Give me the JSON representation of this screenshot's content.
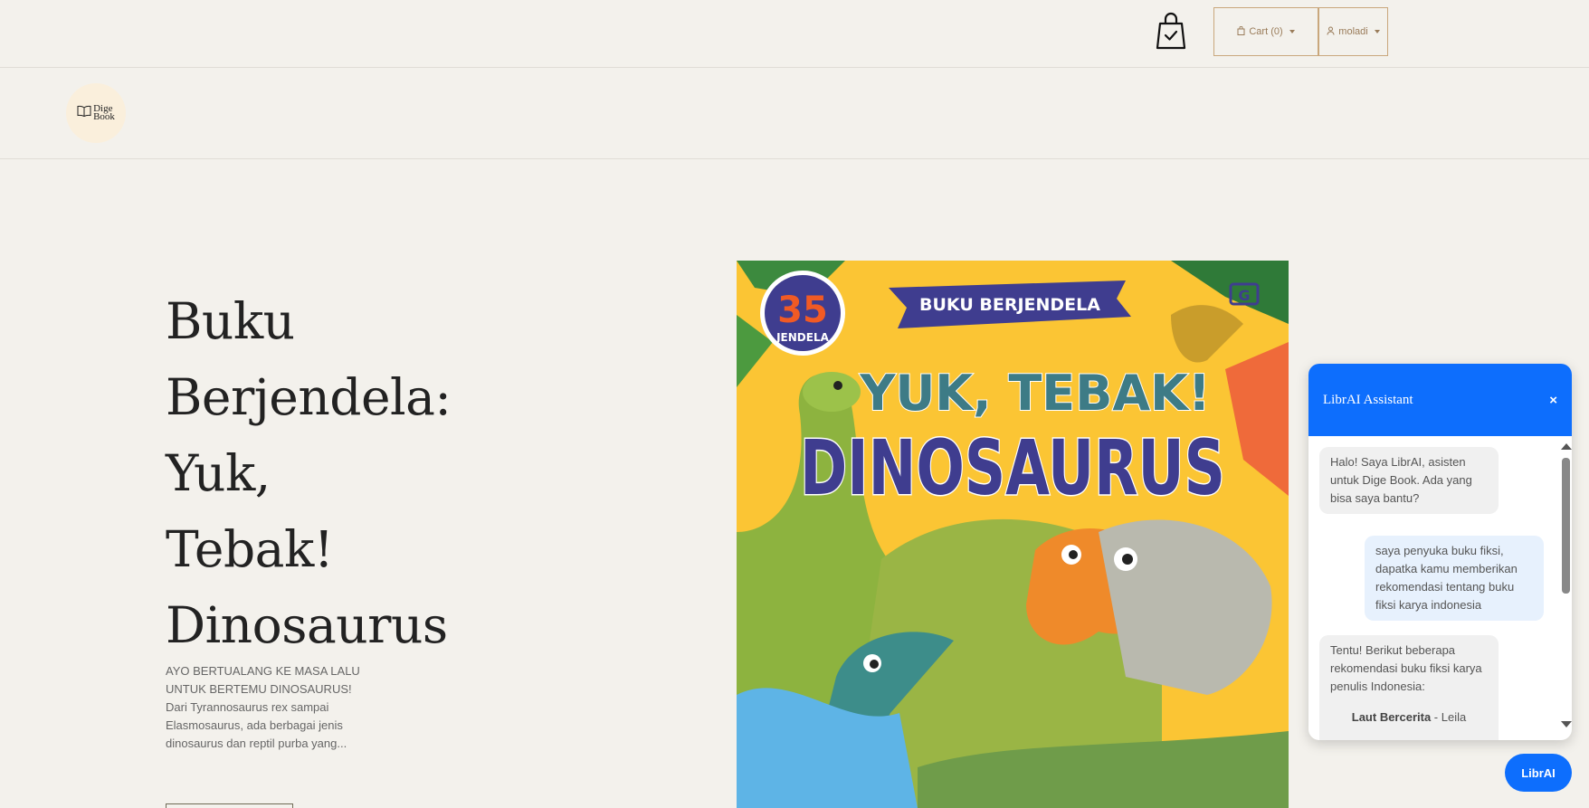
{
  "topbar": {
    "bag_icon": "shopping-bag-check-icon",
    "cart_label": "Cart (0)",
    "cart_icon": "bag-icon",
    "user_label": "moladi",
    "user_icon": "user-icon"
  },
  "logo": {
    "line1": "Dige",
    "line2": "Book",
    "icon": "open-book-icon"
  },
  "hero": {
    "title_lines": [
      "Buku",
      "Berjendela:",
      "Yuk,",
      "Tebak!",
      "Dinosaurus"
    ],
    "description": "AYO BERTUALANG KE MASA LALU UNTUK BERTEMU DINOSAURUS! Dari Tyrannosaurus rex sampai Elasmosaurus, ada berbagai jenis dinosaurus dan reptil purba yang..."
  },
  "cover": {
    "badge_number": "35",
    "badge_label": "JENDELA",
    "series": "BUKU BERJENDELA",
    "title_line1": "YUK, TEBAK!",
    "title_line2": "DINOSAURUS",
    "publisher_mark": "G"
  },
  "chat": {
    "title": "LibrAI Assistant",
    "close_label": "×",
    "messages": [
      {
        "role": "bot",
        "text": "Halo! Saya LibrAI, asisten untuk Dige Book. Ada yang bisa saya bantu?"
      },
      {
        "role": "user",
        "text": "saya penyuka buku fiksi, dapatka kamu memberikan rekomendasi tentang buku fiksi karya indonesia"
      },
      {
        "role": "bot",
        "text": "Tentu! Berikut beberapa rekomendasi buku fiksi karya penulis Indonesia:"
      }
    ],
    "rec_title": "Laut Bercerita",
    "rec_author": " - Leila",
    "launcher_label": "LibrAI"
  },
  "colors": {
    "background": "#f3f1ec",
    "accent_brown": "#c9a77c",
    "chat_blue": "#0d6efd"
  }
}
